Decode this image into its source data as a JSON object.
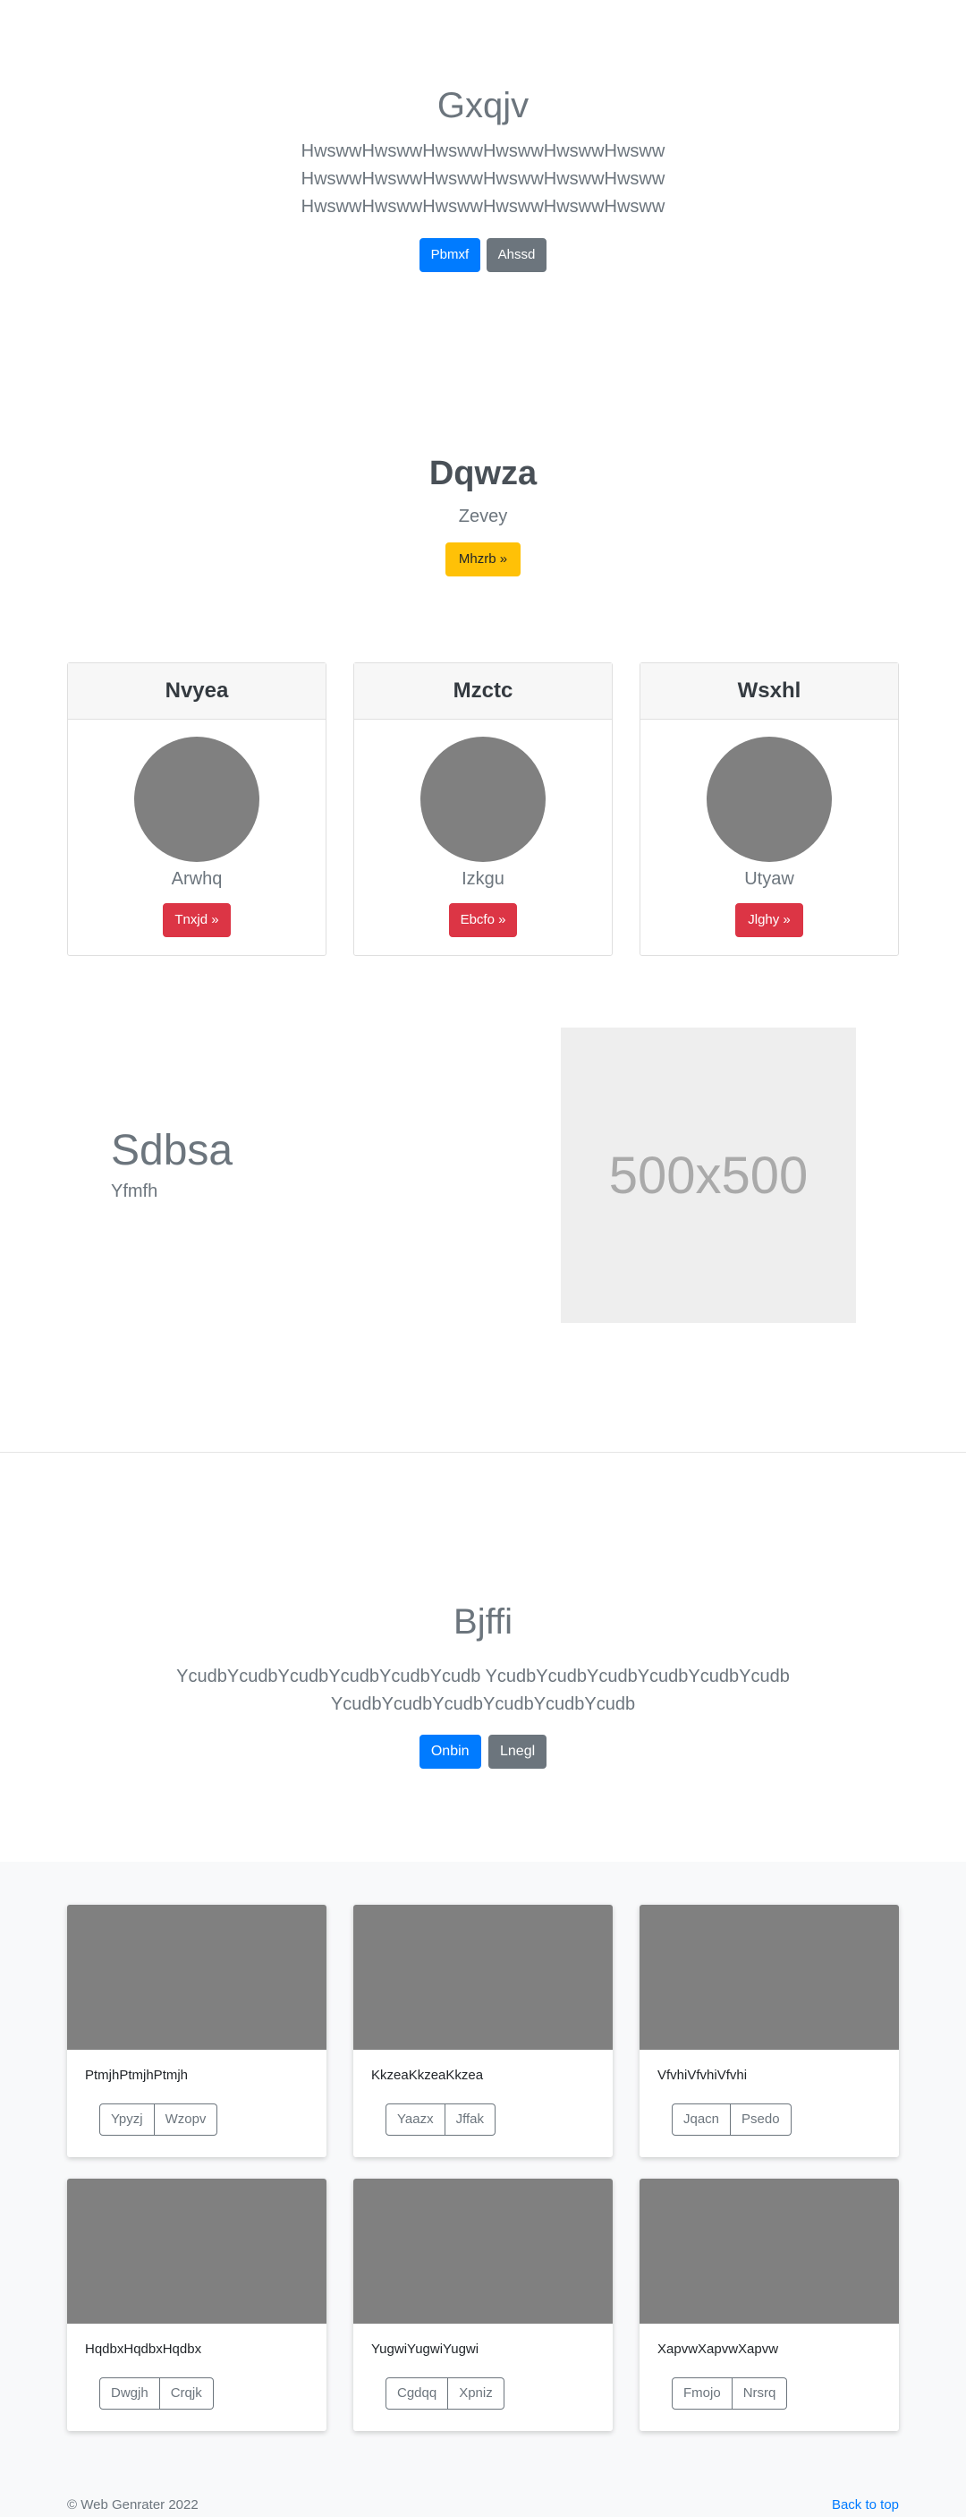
{
  "hero1": {
    "title": "Gxqjv",
    "lead": [
      "HwswwHwswwHwswwHwswwHwswwHwsww",
      "HwswwHwswwHwswwHwswwHwswwHwsww",
      "HwswwHwswwHwswwHwswwHwswwHwsww"
    ],
    "primary_label": "Pbmxf",
    "secondary_label": "Ahssd"
  },
  "promo": {
    "title": "Dqwza",
    "subtitle": "Zevey",
    "button_label": "Mhzrb »"
  },
  "pricing": [
    {
      "header": "Nvyea",
      "name": "Arwhq",
      "button": "Tnxjd »"
    },
    {
      "header": "Mzctc",
      "name": "Izkgu",
      "button": "Ebcfo »"
    },
    {
      "header": "Wsxhl",
      "name": "Utyaw",
      "button": "Jlghy »"
    }
  ],
  "feature": {
    "title": "Sdbsa",
    "subtitle": "Yfmfh",
    "placeholder_text": "500x500"
  },
  "hero2": {
    "title": "Bjffi",
    "lead": [
      "YcudbYcudbYcudbYcudbYcudbYcudb YcudbYcudbYcudbYcudbYcudbYcudb",
      "YcudbYcudbYcudbYcudbYcudbYcudb"
    ],
    "primary_label": "Onbin",
    "secondary_label": "Lnegl"
  },
  "album": [
    {
      "text": "PtmjhPtmjhPtmjh",
      "btn1": "Ypyzj",
      "btn2": "Wzopv"
    },
    {
      "text": "KkzeaKkzeaKkzea",
      "btn1": "Yaazx",
      "btn2": "Jffak"
    },
    {
      "text": "VfvhiVfvhiVfvhi",
      "btn1": "Jqacn",
      "btn2": "Psedo"
    },
    {
      "text": "HqdbxHqdbxHqdbx",
      "btn1": "Dwgjh",
      "btn2": "Crqjk"
    },
    {
      "text": "YugwiYugwiYugwi",
      "btn1": "Cgdqq",
      "btn2": "Xpniz"
    },
    {
      "text": "XapvwXapvwXapvw",
      "btn1": "Fmojo",
      "btn2": "Nrsrq"
    }
  ],
  "footer": {
    "copyright": "© Web Genrater 2022",
    "back_to_top": "Back to top"
  },
  "colors": {
    "primary": "#007bff",
    "secondary": "#6c757d",
    "warning": "#ffc107",
    "danger": "#dc3545",
    "placeholder_gray": "#808080"
  }
}
